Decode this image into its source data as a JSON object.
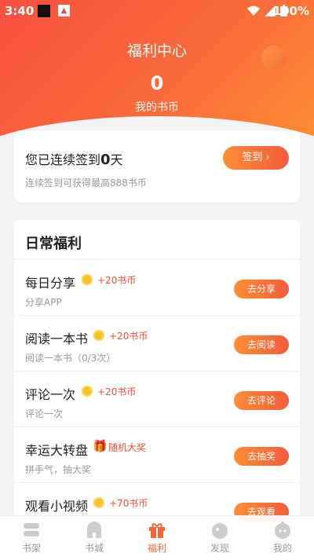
{
  "status": {
    "time": "3:40",
    "battery": "100%"
  },
  "header": {
    "title": "福利中心",
    "coins": "0",
    "coins_label": "我的书币"
  },
  "signin": {
    "prefix": "您已连续签到",
    "days": "0",
    "suffix": "天",
    "hint": "连续签到可获得最高888书币",
    "button": "签到 ›"
  },
  "daily": {
    "title": "日常福利",
    "tasks": [
      {
        "name": "每日分享",
        "reward": "+20书币",
        "desc": "分享APP",
        "button": "去分享",
        "icon": "coin-icon"
      },
      {
        "name": "阅读一本书",
        "reward": "+20书币",
        "desc": "阅读一本书（0/3次）",
        "button": "去阅读",
        "icon": "coin-icon"
      },
      {
        "name": "评论一次",
        "reward": "+20书币",
        "desc": "评论一次",
        "button": "去评论",
        "icon": "coin-icon"
      },
      {
        "name": "幸运大转盘",
        "reward": "随机大奖",
        "desc": "拼手气，抽大奖",
        "button": "去抽奖",
        "icon": "gift-icon"
      },
      {
        "name": "观看小视频",
        "reward": "+70书币",
        "desc": "",
        "button": "去观看",
        "icon": "coin-icon"
      }
    ]
  },
  "tabs": [
    {
      "label": "书架",
      "icon": "bookshelf-icon",
      "active": false
    },
    {
      "label": "书城",
      "icon": "store-icon",
      "active": false
    },
    {
      "label": "福利",
      "icon": "gift-icon",
      "active": true
    },
    {
      "label": "发现",
      "icon": "discover-icon",
      "active": false
    },
    {
      "label": "我的",
      "icon": "profile-icon",
      "active": false
    }
  ],
  "colors": {
    "accent": "#f4643b",
    "hero_start": "#f8503e",
    "hero_end": "#fd8f32",
    "reward": "#f04b3a"
  }
}
